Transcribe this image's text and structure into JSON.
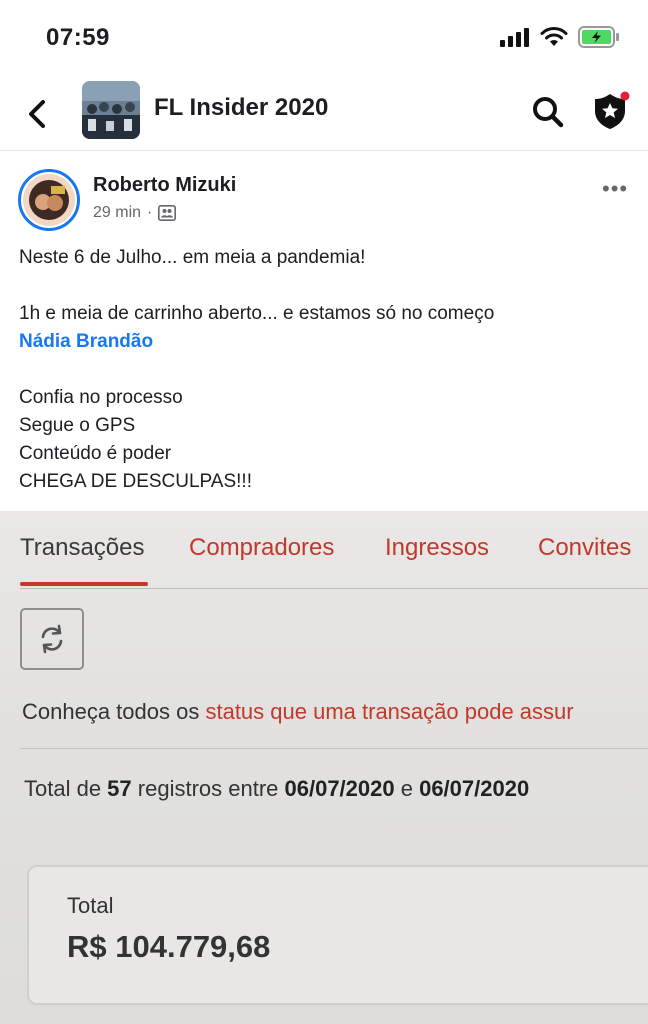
{
  "status_bar": {
    "time": "07:59",
    "icons": [
      "signal-icon",
      "wifi-icon",
      "battery-charging-icon"
    ],
    "battery_color": "#4cd964"
  },
  "nav": {
    "group_title": "FL Insider 2020",
    "icons": [
      "back-chevron-icon",
      "search-icon",
      "admin-badge-icon"
    ]
  },
  "post": {
    "author": "Roberto Mizuki",
    "time": "29 min",
    "separator": "·",
    "more": "•••",
    "lines": {
      "l1": "Neste 6 de Julho... em meia a pandemia!",
      "l2": "1h e meia de carrinho aberto... e estamos só no começo",
      "mention": "Nádia Brandão",
      "l3": "Confia no processo",
      "l4": "Segue o GPS",
      "l5": "Conteúdo é poder",
      "l6": "CHEGA DE DESCULPAS!!!"
    },
    "mention_color": "#1877f2"
  },
  "screenshot": {
    "tabs": [
      "Transações",
      "Compradores",
      "Ingressos",
      "Convites"
    ],
    "active_tab": "Transações",
    "accent_color": "#c0392b",
    "info": {
      "prefix": "Conheça todos os ",
      "link": "status que uma transação pode assur"
    },
    "summary": {
      "prefix": "Total de ",
      "count": "57",
      "middle": " registros entre ",
      "date_start": "06/07/2020",
      "and": " e ",
      "date_end": "06/07/2020"
    },
    "total_label": "Total",
    "total_value": "R$ 104.779,68"
  }
}
